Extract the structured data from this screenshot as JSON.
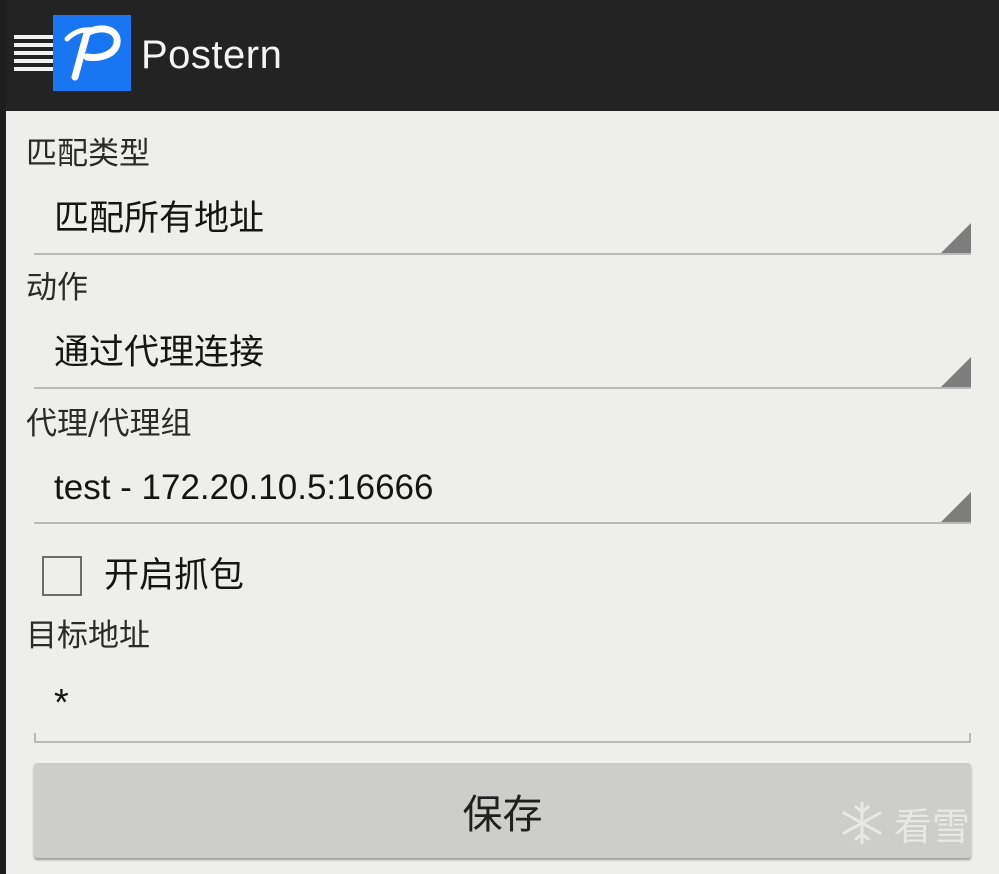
{
  "app": {
    "title": "Postern",
    "logo_letter": "P"
  },
  "form": {
    "match_type": {
      "label": "匹配类型",
      "value": "匹配所有地址"
    },
    "action": {
      "label": "动作",
      "value": "通过代理连接"
    },
    "proxy": {
      "label": "代理/代理组",
      "value": "test - 172.20.10.5:16666"
    },
    "capture": {
      "label": "开启抓包",
      "checked": false
    },
    "target": {
      "label": "目标地址",
      "value": "*"
    },
    "save_label": "保存"
  },
  "watermark": {
    "text": "看雪"
  },
  "colors": {
    "action_bar": "#232323",
    "logo_bg": "#1976f2",
    "background": "#eeeeed",
    "button_bg": "#cdcdcb"
  }
}
